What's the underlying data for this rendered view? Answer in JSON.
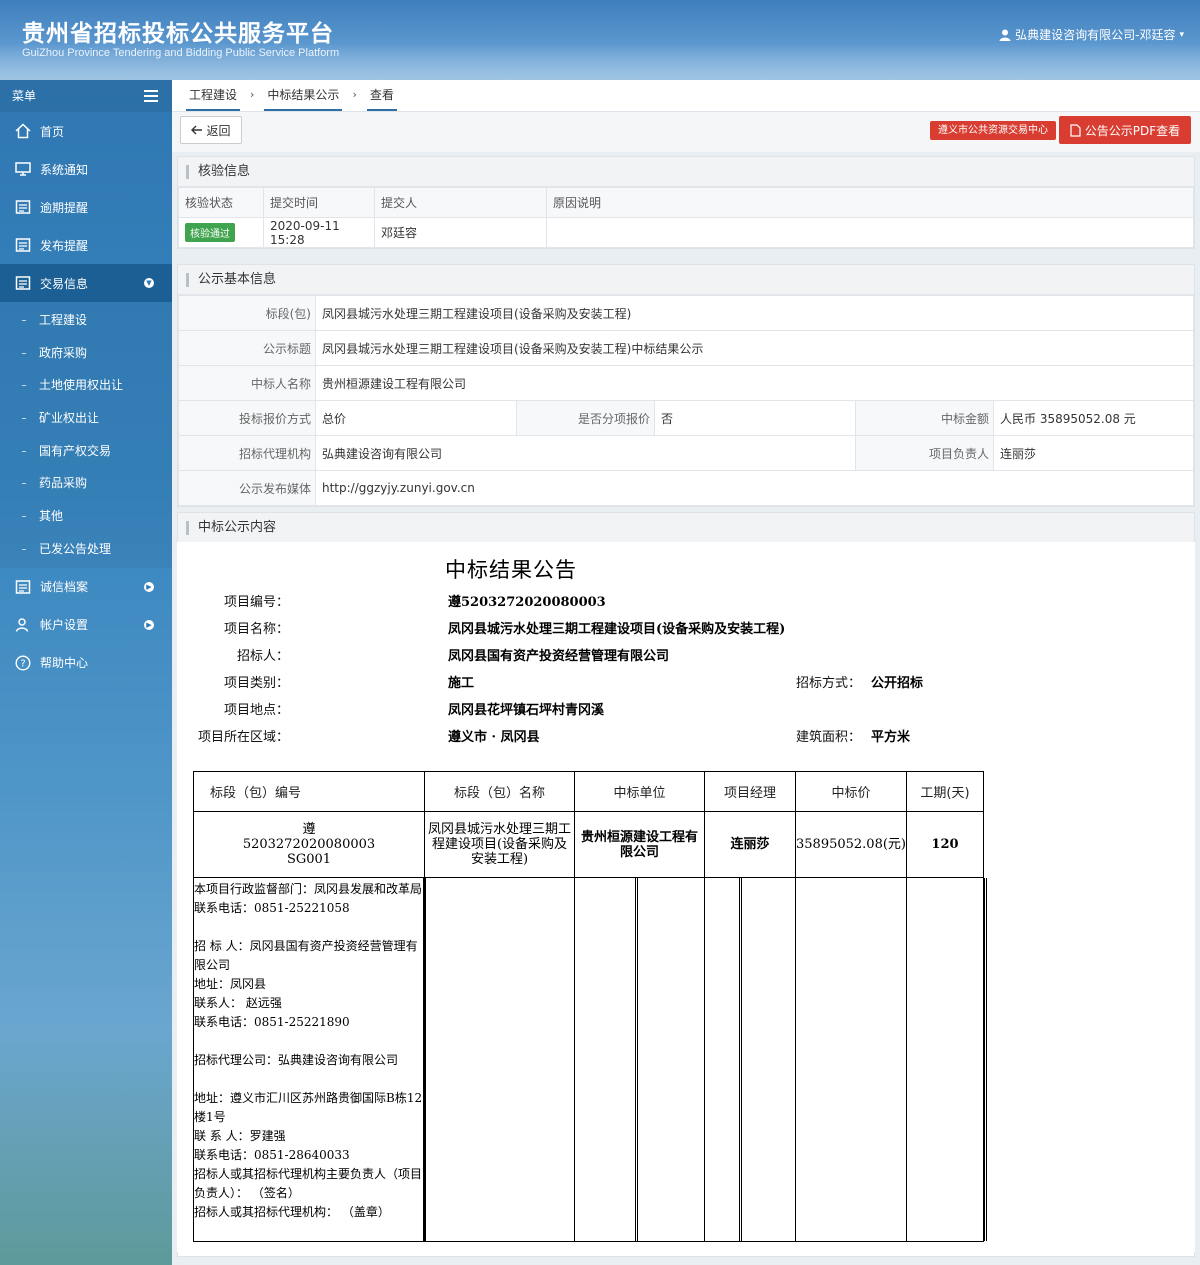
{
  "header": {
    "title": "贵州省招标投标公共服务平台",
    "subtitle": "GuiZhou Province Tendering and Bidding Public Service Platform",
    "user": "弘典建设咨询有限公司-邓廷容"
  },
  "sidebar": {
    "menu_label": "菜单",
    "items": [
      {
        "label": "首页"
      },
      {
        "label": "系统通知"
      },
      {
        "label": "逾期提醒"
      },
      {
        "label": "发布提醒"
      },
      {
        "label": "交易信息"
      },
      {
        "label": "诚信档案"
      },
      {
        "label": "帐户设置"
      },
      {
        "label": "帮助中心"
      }
    ],
    "subitems": [
      {
        "label": "工程建设"
      },
      {
        "label": "政府采购"
      },
      {
        "label": "土地使用权出让"
      },
      {
        "label": "矿业权出让"
      },
      {
        "label": "国有产权交易"
      },
      {
        "label": "药品采购"
      },
      {
        "label": "其他"
      },
      {
        "label": "已发公告处理"
      }
    ]
  },
  "breadcrumb": [
    "工程建设",
    "中标结果公示",
    "查看"
  ],
  "toolbar": {
    "back": "返回",
    "center_link": "遵义市公共资源交易中心",
    "pdf": "公告公示PDF查看"
  },
  "verify": {
    "title": "核验信息",
    "headers": [
      "核验状态",
      "提交时间",
      "提交人",
      "原因说明"
    ],
    "status": "核验通过",
    "time": "2020-09-11 15:28",
    "submitter": "邓廷容",
    "reason": ""
  },
  "basic": {
    "title": "公示基本信息",
    "section_label": "标段(包)",
    "section": "凤冈县城污水处理三期工程建设项目(设备采购及安装工程)",
    "notice_label": "公示标题",
    "notice": "凤冈县城污水处理三期工程建设项目(设备采购及安装工程)中标结果公示",
    "winner_label": "中标人名称",
    "winner": "贵州桓源建设工程有限公司",
    "quote_label": "投标报价方式",
    "quote": "总价",
    "split_label": "是否分项报价",
    "split": "否",
    "amount_label": "中标金额",
    "amount": "人民币 35895052.08 元",
    "agency_label": "招标代理机构",
    "agency": "弘典建设咨询有限公司",
    "manager_label": "项目负责人",
    "manager": "连丽莎",
    "media_label": "公示发布媒体",
    "media": "http://ggzyjy.zunyi.gov.cn"
  },
  "content": {
    "title": "中标公示内容",
    "doc_title": "中标结果公告",
    "fields": {
      "code_label": "项目编号：",
      "code": "遵5203272020080003",
      "name_label": "项目名称：",
      "name": "凤冈县城污水处理三期工程建设项目(设备采购及安装工程)",
      "owner_label": "招标人：",
      "owner": "凤冈县国有资产投资经营管理有限公司",
      "type_label": "项目类别：",
      "type": "施工",
      "method_label": "招标方式：",
      "method": "公开招标",
      "site_label": "项目地点：",
      "site": "凤冈县花坪镇石坪村青冈溪",
      "region_label": "项目所在区域：",
      "region": "遵义市 · 凤冈县",
      "area_label": "建筑面积：",
      "area": "平方米"
    },
    "table": {
      "headers": [
        "标段（包）编号",
        "标段（包）名称",
        "中标单位",
        "项目经理",
        "中标价",
        "工期(天)"
      ],
      "row": {
        "code_a": "遵",
        "code_b": "5203272020080003",
        "code_c": "SG001",
        "name": "凤冈县城污水处理三期工程建设项目(设备采购及安装工程)",
        "unit": "贵州桓源建设工程有限公司",
        "pm": "连丽莎",
        "price": "35895052.08(元)",
        "days": "120"
      },
      "notes": [
        "本项目行政监督部门：凤冈县发展和改革局",
        "联系电话：0851-25221058",
        "",
        "招 标 人：凤冈县国有资产投资经营管理有限公司",
        "地址：凤冈县",
        "联系人： 赵远强",
        "联系电话：0851-25221890",
        "",
        "招标代理公司：弘典建设咨询有限公司",
        "",
        "地址：遵义市汇川区苏州路贵御国际B栋12楼1号",
        "联 系 人：罗建强",
        "联系电话：0851-28640033",
        "招标人或其招标代理机构主要负责人（项目负责人）： （签名）",
        "招标人或其招标代理机构： （盖章）"
      ]
    }
  },
  "colors": {
    "header": "#3f7fbd",
    "sidebar": "#2f77b2",
    "sidebar_active": "#1b5f95",
    "danger": "#d93c31",
    "success": "#3fa44d"
  }
}
